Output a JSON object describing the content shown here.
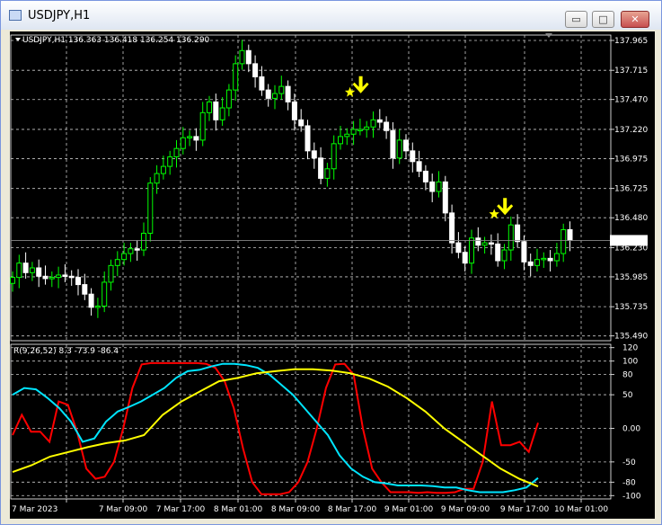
{
  "window": {
    "title": "USDJPY,H1",
    "minimize_glyph": "▭",
    "maximize_glyph": "□",
    "close_glyph": "✕"
  },
  "chart_header": {
    "text": "USDJPY,H1  136.363 136.418 136.254 136.290"
  },
  "current_price": "136.290",
  "indicator_header": {
    "text": "R(9,26,52) 8.3 -73.9 -86.4"
  },
  "colors": {
    "bull": "#00ff00",
    "bear": "#ffffff",
    "grid": "#c8c8c8",
    "signal": "#ffff00",
    "r_fast": "#ff0000",
    "r_mid": "#00e5ff",
    "r_slow": "#ffff00"
  },
  "chart_data": [
    {
      "type": "candlestick",
      "symbol": "USDJPY",
      "timeframe": "H1",
      "price_axis_ticks": [
        137.965,
        137.715,
        137.47,
        137.22,
        136.975,
        136.725,
        136.48,
        136.23,
        135.985,
        135.735,
        135.49
      ],
      "time_axis_ticks": [
        "7 Mar 2023",
        "7 Mar 09:00",
        "7 Mar 17:00",
        "8 Mar 01:00",
        "8 Mar 09:00",
        "8 Mar 17:00",
        "9 Mar 01:00",
        "9 Mar 09:00",
        "9 Mar 17:00",
        "10 Mar 01:00"
      ],
      "closes": [
        135.98,
        136.1,
        136.02,
        136.06,
        135.99,
        135.97,
        135.98,
        136.0,
        135.99,
        135.98,
        135.92,
        135.84,
        135.73,
        135.74,
        135.94,
        136.08,
        136.13,
        136.18,
        136.22,
        136.21,
        136.35,
        136.77,
        136.85,
        136.91,
        136.99,
        137.06,
        137.15,
        137.16,
        137.13,
        137.36,
        137.45,
        137.3,
        137.4,
        137.55,
        137.77,
        137.88,
        137.77,
        137.66,
        137.55,
        137.48,
        137.52,
        137.58,
        137.45,
        137.3,
        137.25,
        137.04,
        136.98,
        136.81,
        136.89,
        137.1,
        137.16,
        137.18,
        137.22,
        137.22,
        137.24,
        137.3,
        137.28,
        137.21,
        136.98,
        137.13,
        137.04,
        136.95,
        136.87,
        136.78,
        136.7,
        136.78,
        136.52,
        136.27,
        136.19,
        136.1,
        136.31,
        136.25,
        136.27,
        136.26,
        136.12,
        136.21,
        136.42,
        136.28,
        136.11,
        136.08,
        136.13,
        136.14,
        136.12,
        136.18,
        136.38,
        136.29
      ],
      "signals": [
        {
          "marker": "star",
          "arrow": "down",
          "near": 137.47
        },
        {
          "marker": "star",
          "arrow": "down",
          "near": 136.45
        }
      ],
      "current_price_line": 136.29
    },
    {
      "type": "line",
      "name": "R(9,26,52)",
      "y_ticks": [
        120,
        100,
        80,
        50,
        0.0,
        -50,
        -80,
        -100
      ],
      "ylim": [
        -100,
        120
      ],
      "series": [
        {
          "name": "R fast",
          "color": "#ff0000",
          "last": 8.3,
          "values": [
            -10,
            20,
            -5,
            -5,
            -20,
            40,
            35,
            -5,
            -60,
            -75,
            -72,
            -50,
            0,
            60,
            95,
            97,
            97,
            97,
            97,
            97,
            97,
            96,
            90,
            70,
            30,
            -30,
            -80,
            -98,
            -98,
            -98,
            -95,
            -80,
            -50,
            0,
            60,
            95,
            96,
            80,
            0,
            -60,
            -80,
            -95,
            -95,
            -95,
            -96,
            -95,
            -96,
            -96,
            -95,
            -90,
            -90,
            -50,
            40,
            -25,
            -25,
            -20,
            -35,
            8.3
          ]
        },
        {
          "name": "R mid",
          "color": "#00e5ff",
          "last": -73.9,
          "values": [
            50,
            60,
            58,
            45,
            30,
            10,
            -20,
            -15,
            10,
            25,
            32,
            40,
            50,
            60,
            75,
            85,
            87,
            92,
            96,
            96,
            94,
            90,
            80,
            65,
            50,
            30,
            10,
            -10,
            -40,
            -60,
            -72,
            -80,
            -82,
            -85,
            -85,
            -85,
            -86,
            -88,
            -88,
            -92,
            -95,
            -95,
            -95,
            -92,
            -88,
            -73.9
          ]
        },
        {
          "name": "R slow",
          "color": "#ffff00",
          "last": -86.4,
          "values": [
            -65,
            -55,
            -42,
            -35,
            -28,
            -22,
            -18,
            -10,
            20,
            40,
            55,
            70,
            75,
            82,
            85,
            88,
            88,
            86,
            82,
            74,
            62,
            45,
            25,
            0,
            -20,
            -40,
            -60,
            -75,
            -86.4
          ]
        }
      ]
    }
  ]
}
